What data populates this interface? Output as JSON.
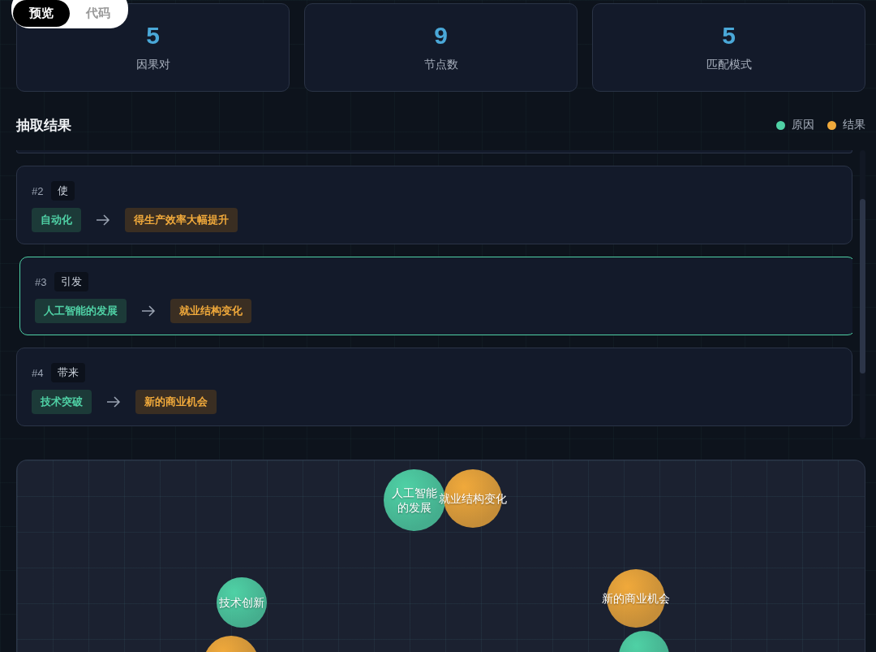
{
  "view_toggle": [
    {
      "label": "预览",
      "selected": true
    },
    {
      "label": "代码",
      "selected": false
    }
  ],
  "stats": [
    {
      "value": "5",
      "label": "因果对"
    },
    {
      "value": "9",
      "label": "节点数"
    },
    {
      "value": "5",
      "label": "匹配模式"
    }
  ],
  "section_title": "抽取结果",
  "legend": [
    {
      "label": "原因",
      "color": "#4fd1a5"
    },
    {
      "label": "结果",
      "color": "#f0a93b"
    }
  ],
  "results": [
    {
      "index": "#2",
      "connective": "使",
      "cause": "自动化",
      "effect": "得生产效率大幅提升",
      "selected": false
    },
    {
      "index": "#3",
      "connective": "引发",
      "cause": "人工智能的发展",
      "effect": "就业结构变化",
      "selected": true
    },
    {
      "index": "#4",
      "connective": "带来",
      "cause": "技术突破",
      "effect": "新的商业机会",
      "selected": false
    }
  ],
  "graph": {
    "nodes": [
      {
        "label": "人工智能的发展",
        "kind": "cause"
      },
      {
        "label": "就业结构变化",
        "kind": "effect"
      },
      {
        "label": "技术创新",
        "kind": "cause"
      },
      {
        "kind": "effect"
      },
      {
        "label": "新的商业机会",
        "kind": "effect"
      },
      {
        "kind": "cause"
      }
    ]
  }
}
